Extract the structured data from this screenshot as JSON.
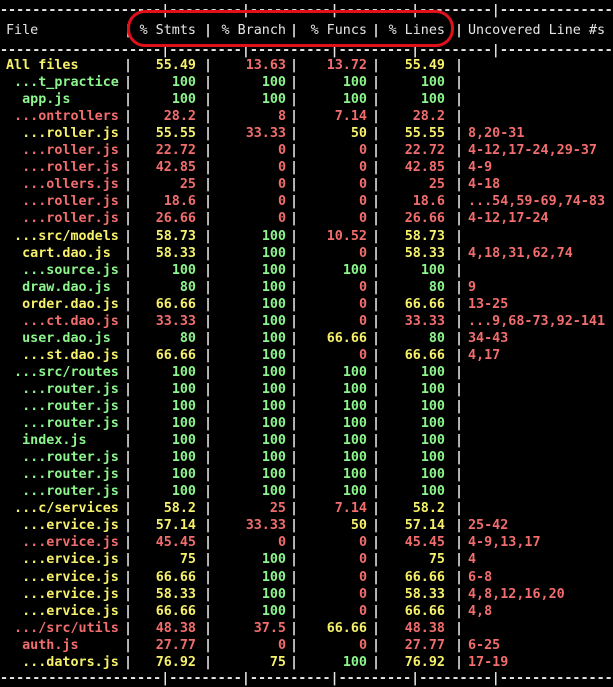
{
  "header": {
    "file": "File",
    "stmts": "% Stmts",
    "branch": "% Branch",
    "funcs": "% Funcs",
    "lines": "% Lines",
    "uncovered": "Uncovered Line #s"
  },
  "colors": {
    "high": "#8cf58c",
    "medium": "#f6f06a",
    "low": "#f26d6d",
    "highlight_ring": "#e0101a"
  },
  "rows": [
    {
      "file": "All files",
      "stmts": "55.49",
      "branch": "13.63",
      "funcs": "13.72",
      "lines": "55.49",
      "uncovered": "",
      "c": [
        "y",
        "y",
        "r",
        "r",
        "y",
        "r"
      ]
    },
    {
      "file": " ...t_practice",
      "stmts": "100",
      "branch": "100",
      "funcs": "100",
      "lines": "100",
      "uncovered": "",
      "c": [
        "g",
        "g",
        "g",
        "g",
        "g",
        "g"
      ]
    },
    {
      "file": "  app.js",
      "stmts": "100",
      "branch": "100",
      "funcs": "100",
      "lines": "100",
      "uncovered": "",
      "c": [
        "g",
        "g",
        "g",
        "g",
        "g",
        "g"
      ]
    },
    {
      "file": " ...ontrollers",
      "stmts": "28.2",
      "branch": "8",
      "funcs": "7.14",
      "lines": "28.2",
      "uncovered": "",
      "c": [
        "r",
        "r",
        "r",
        "r",
        "r",
        "r"
      ]
    },
    {
      "file": "  ...roller.js",
      "stmts": "55.55",
      "branch": "33.33",
      "funcs": "50",
      "lines": "55.55",
      "uncovered": "8,20-31",
      "c": [
        "y",
        "y",
        "r",
        "y",
        "y",
        "r"
      ]
    },
    {
      "file": "  ...roller.js",
      "stmts": "22.72",
      "branch": "0",
      "funcs": "0",
      "lines": "22.72",
      "uncovered": "4-12,17-24,29-37",
      "c": [
        "r",
        "r",
        "r",
        "r",
        "r",
        "r"
      ]
    },
    {
      "file": "  ...roller.js",
      "stmts": "42.85",
      "branch": "0",
      "funcs": "0",
      "lines": "42.85",
      "uncovered": "4-9",
      "c": [
        "r",
        "r",
        "r",
        "r",
        "r",
        "r"
      ]
    },
    {
      "file": "  ...ollers.js",
      "stmts": "25",
      "branch": "0",
      "funcs": "0",
      "lines": "25",
      "uncovered": "4-18",
      "c": [
        "r",
        "r",
        "r",
        "r",
        "r",
        "r"
      ]
    },
    {
      "file": "  ...roller.js",
      "stmts": "18.6",
      "branch": "0",
      "funcs": "0",
      "lines": "18.6",
      "uncovered": "...54,59-69,74-83",
      "c": [
        "r",
        "r",
        "r",
        "r",
        "r",
        "r"
      ]
    },
    {
      "file": "  ...roller.js",
      "stmts": "26.66",
      "branch": "0",
      "funcs": "0",
      "lines": "26.66",
      "uncovered": "4-12,17-24",
      "c": [
        "r",
        "r",
        "r",
        "r",
        "r",
        "r"
      ]
    },
    {
      "file": " ...src/models",
      "stmts": "58.73",
      "branch": "100",
      "funcs": "10.52",
      "lines": "58.73",
      "uncovered": "",
      "c": [
        "y",
        "y",
        "g",
        "r",
        "y",
        "y"
      ]
    },
    {
      "file": "  cart.dao.js",
      "stmts": "58.33",
      "branch": "100",
      "funcs": "0",
      "lines": "58.33",
      "uncovered": "4,18,31,62,74",
      "c": [
        "y",
        "y",
        "g",
        "r",
        "y",
        "r"
      ]
    },
    {
      "file": "  ...source.js",
      "stmts": "100",
      "branch": "100",
      "funcs": "100",
      "lines": "100",
      "uncovered": "",
      "c": [
        "g",
        "g",
        "g",
        "g",
        "g",
        "g"
      ]
    },
    {
      "file": "  draw.dao.js",
      "stmts": "80",
      "branch": "100",
      "funcs": "0",
      "lines": "80",
      "uncovered": "9",
      "c": [
        "g",
        "g",
        "g",
        "r",
        "g",
        "r"
      ]
    },
    {
      "file": "  order.dao.js",
      "stmts": "66.66",
      "branch": "100",
      "funcs": "0",
      "lines": "66.66",
      "uncovered": "13-25",
      "c": [
        "y",
        "y",
        "g",
        "r",
        "y",
        "r"
      ]
    },
    {
      "file": "  ...ct.dao.js",
      "stmts": "33.33",
      "branch": "100",
      "funcs": "0",
      "lines": "33.33",
      "uncovered": "...9,68-73,92-141",
      "c": [
        "r",
        "r",
        "g",
        "r",
        "r",
        "r"
      ]
    },
    {
      "file": "  user.dao.js",
      "stmts": "80",
      "branch": "100",
      "funcs": "66.66",
      "lines": "80",
      "uncovered": "34-43",
      "c": [
        "g",
        "g",
        "g",
        "y",
        "g",
        "r"
      ]
    },
    {
      "file": "  ...st.dao.js",
      "stmts": "66.66",
      "branch": "100",
      "funcs": "0",
      "lines": "66.66",
      "uncovered": "4,17",
      "c": [
        "y",
        "y",
        "g",
        "r",
        "y",
        "r"
      ]
    },
    {
      "file": " ...src/routes",
      "stmts": "100",
      "branch": "100",
      "funcs": "100",
      "lines": "100",
      "uncovered": "",
      "c": [
        "g",
        "g",
        "g",
        "g",
        "g",
        "g"
      ]
    },
    {
      "file": "  ...router.js",
      "stmts": "100",
      "branch": "100",
      "funcs": "100",
      "lines": "100",
      "uncovered": "",
      "c": [
        "g",
        "g",
        "g",
        "g",
        "g",
        "g"
      ]
    },
    {
      "file": "  ...router.js",
      "stmts": "100",
      "branch": "100",
      "funcs": "100",
      "lines": "100",
      "uncovered": "",
      "c": [
        "g",
        "g",
        "g",
        "g",
        "g",
        "g"
      ]
    },
    {
      "file": "  ...router.js",
      "stmts": "100",
      "branch": "100",
      "funcs": "100",
      "lines": "100",
      "uncovered": "",
      "c": [
        "g",
        "g",
        "g",
        "g",
        "g",
        "g"
      ]
    },
    {
      "file": "  index.js",
      "stmts": "100",
      "branch": "100",
      "funcs": "100",
      "lines": "100",
      "uncovered": "",
      "c": [
        "g",
        "g",
        "g",
        "g",
        "g",
        "g"
      ]
    },
    {
      "file": "  ...router.js",
      "stmts": "100",
      "branch": "100",
      "funcs": "100",
      "lines": "100",
      "uncovered": "",
      "c": [
        "g",
        "g",
        "g",
        "g",
        "g",
        "g"
      ]
    },
    {
      "file": "  ...router.js",
      "stmts": "100",
      "branch": "100",
      "funcs": "100",
      "lines": "100",
      "uncovered": "",
      "c": [
        "g",
        "g",
        "g",
        "g",
        "g",
        "g"
      ]
    },
    {
      "file": "  ...router.js",
      "stmts": "100",
      "branch": "100",
      "funcs": "100",
      "lines": "100",
      "uncovered": "",
      "c": [
        "g",
        "g",
        "g",
        "g",
        "g",
        "g"
      ]
    },
    {
      "file": " ...c/services",
      "stmts": "58.2",
      "branch": "25",
      "funcs": "7.14",
      "lines": "58.2",
      "uncovered": "",
      "c": [
        "y",
        "y",
        "r",
        "r",
        "y",
        "y"
      ]
    },
    {
      "file": "  ...ervice.js",
      "stmts": "57.14",
      "branch": "33.33",
      "funcs": "50",
      "lines": "57.14",
      "uncovered": "25-42",
      "c": [
        "y",
        "y",
        "r",
        "y",
        "y",
        "r"
      ]
    },
    {
      "file": "  ...ervice.js",
      "stmts": "45.45",
      "branch": "0",
      "funcs": "0",
      "lines": "45.45",
      "uncovered": "4-9,13,17",
      "c": [
        "r",
        "r",
        "r",
        "r",
        "r",
        "r"
      ]
    },
    {
      "file": "  ...ervice.js",
      "stmts": "75",
      "branch": "100",
      "funcs": "0",
      "lines": "75",
      "uncovered": "4",
      "c": [
        "y",
        "y",
        "g",
        "r",
        "y",
        "r"
      ]
    },
    {
      "file": "  ...ervice.js",
      "stmts": "66.66",
      "branch": "100",
      "funcs": "0",
      "lines": "66.66",
      "uncovered": "6-8",
      "c": [
        "y",
        "y",
        "g",
        "r",
        "y",
        "r"
      ]
    },
    {
      "file": "  ...ervice.js",
      "stmts": "58.33",
      "branch": "100",
      "funcs": "0",
      "lines": "58.33",
      "uncovered": "4,8,12,16,20",
      "c": [
        "y",
        "y",
        "g",
        "r",
        "y",
        "r"
      ]
    },
    {
      "file": "  ...ervice.js",
      "stmts": "66.66",
      "branch": "100",
      "funcs": "0",
      "lines": "66.66",
      "uncovered": "4,8",
      "c": [
        "y",
        "y",
        "g",
        "r",
        "y",
        "r"
      ]
    },
    {
      "file": " .../src/utils",
      "stmts": "48.38",
      "branch": "37.5",
      "funcs": "66.66",
      "lines": "48.38",
      "uncovered": "",
      "c": [
        "r",
        "r",
        "r",
        "y",
        "r",
        "r"
      ]
    },
    {
      "file": "  auth.js",
      "stmts": "27.77",
      "branch": "0",
      "funcs": "0",
      "lines": "27.77",
      "uncovered": "6-25",
      "c": [
        "r",
        "r",
        "r",
        "r",
        "r",
        "r"
      ]
    },
    {
      "file": "  ...dators.js",
      "stmts": "76.92",
      "branch": "75",
      "funcs": "100",
      "lines": "76.92",
      "uncovered": "17-19",
      "c": [
        "y",
        "y",
        "y",
        "g",
        "y",
        "r"
      ]
    }
  ]
}
